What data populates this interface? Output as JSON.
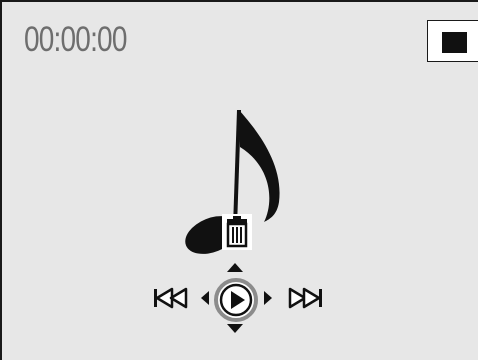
{
  "recorder": {
    "elapsed_time": "00:00:00"
  },
  "icons": {
    "stop": "stop-icon",
    "note": "music-note-icon",
    "delete": "trash-icon",
    "previous": "skip-previous-icon",
    "next": "skip-next-icon",
    "play": "play-icon",
    "dpad_left": "arrow-left-icon",
    "dpad_right": "arrow-right-icon",
    "dpad_up": "arrow-up-icon",
    "dpad_down": "arrow-down-icon"
  },
  "colors": {
    "background": "#e7e7e7",
    "timer_text": "#6e6e6e",
    "icon": "#111111",
    "play_ring": "#8c8c8c"
  }
}
